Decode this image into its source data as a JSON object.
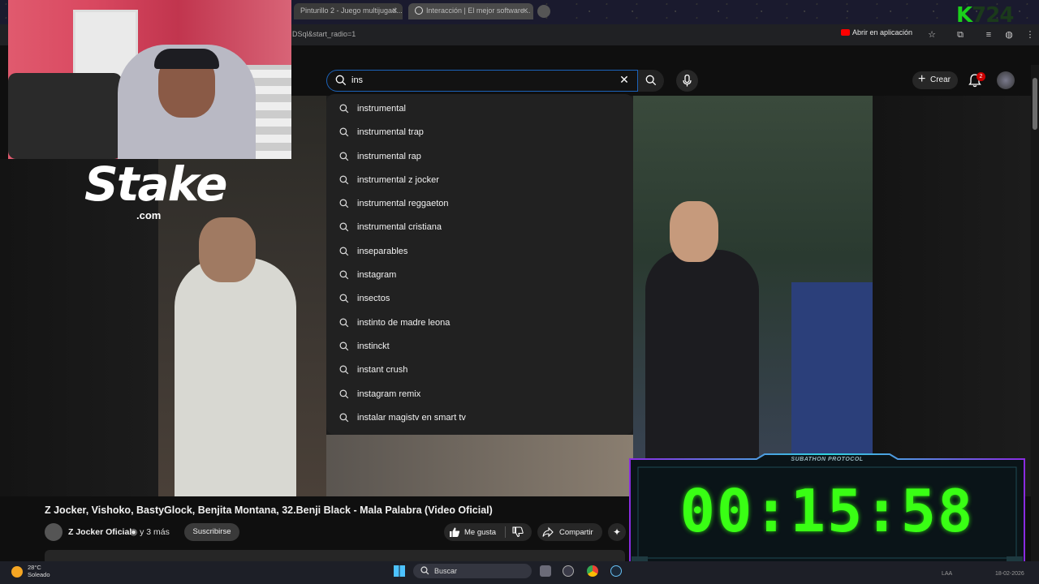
{
  "browser": {
    "tabs": [
      {
        "label": "Pinturillo 2 - Juego multijugad..."
      },
      {
        "label": "Interacción | El mejor software..."
      }
    ],
    "url_fragment": "DSql&start_radio=1",
    "open_app_label": "Abrir en aplicación",
    "brand_overlay": "K",
    "brand_overlay_tail": "724"
  },
  "overlay": {
    "sponsor_logo": "Stake",
    "sponsor_domain": ".com"
  },
  "header": {
    "search_value": "ins",
    "create_label": "Crear",
    "notification_count": "2"
  },
  "suggestions": [
    "instrumental",
    "instrumental trap",
    "instrumental rap",
    "instrumental z jocker",
    "instrumental reggaeton",
    "instrumental cristiana",
    "inseparables",
    "instagram",
    "insectos",
    "instinto de madre leona",
    "instinckt",
    "instant crush",
    "instagram remix",
    "instalar magistv en smart tv"
  ],
  "video": {
    "title": "Z Jocker, Vishoko, BastyGlock, Benjita Montana, 32.Benji Black - Mala Palabra (Video Oficial)",
    "channel": "Z Jocker Oficial",
    "ago": "y 3 más",
    "subscribe_label": "Suscribirse",
    "like_label": "Me gusta",
    "share_label": "Compartir"
  },
  "timer": {
    "label": "SUBATHON PROTOCOL",
    "time": "00:15:58",
    "color": "#39ff14"
  },
  "taskbar": {
    "temp": "28°C",
    "weather": "Soleado",
    "search_label": "Buscar",
    "lang": "LAA",
    "date": "18-02-2026"
  }
}
